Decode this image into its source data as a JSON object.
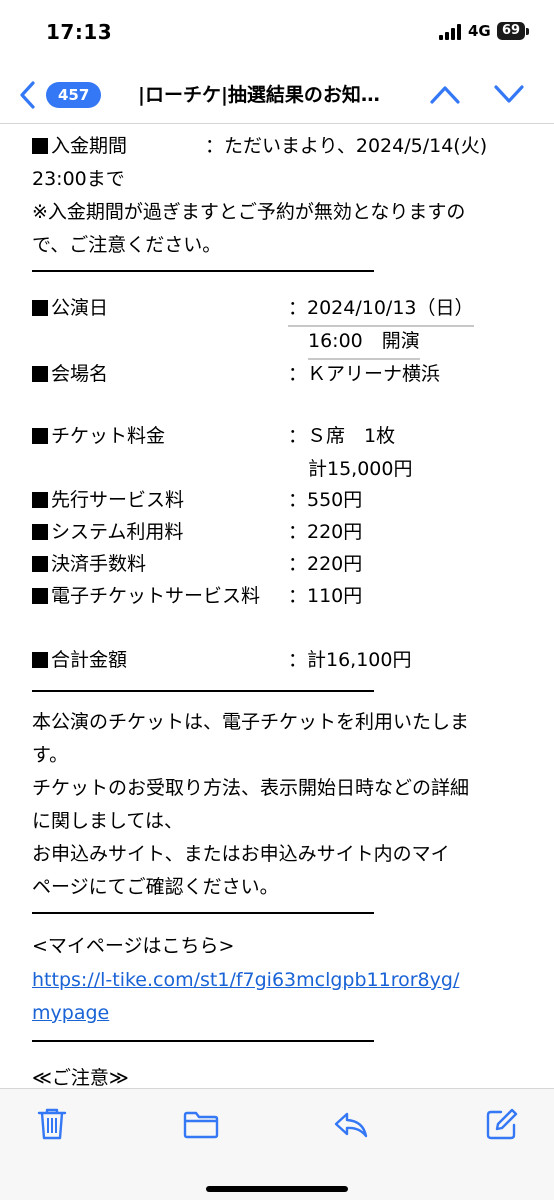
{
  "status": {
    "time": "17:13",
    "network": "4G",
    "battery": "69"
  },
  "nav": {
    "back_count": "457",
    "title": "|ローチケ|抽選結果のお知…"
  },
  "colors": {
    "accent": "#3478f6",
    "link": "#1a63d6"
  },
  "email": {
    "payment_period_label": "入金期間",
    "payment_period_value": "：ただいまより、2024/5/14(火)",
    "payment_period_end": "23:00まで",
    "notice_line1": "※入金期間が過ぎますとご予約が無効となりますの",
    "notice_line2": "で、ご注意ください。",
    "perf_date_label": "公演日",
    "perf_date_value": "：2024/10/13（日）",
    "perf_time_value": "16:00　開演",
    "venue_label": "会場名",
    "venue_value": "：Ｋアリーナ横浜",
    "ticket_fee_label": "チケット料金",
    "ticket_fee_value": "：Ｓ席　1枚",
    "ticket_fee_total": "計15,000円",
    "presale_fee_label": "先行サービス料",
    "presale_fee_value": "：550円",
    "system_fee_label": "システム利用料",
    "system_fee_value": "：220円",
    "settlement_fee_label": "決済手数料",
    "settlement_fee_value": "：220円",
    "eticket_fee_label": "電子チケットサービス料",
    "eticket_fee_value": "：110円",
    "total_label": "合計金額",
    "total_value": "：計16,100円",
    "eticket_info_line1": "本公演のチケットは、電子チケットを利用いたしま",
    "eticket_info_line2": "す。",
    "eticket_info_line3": "チケットのお受取り方法、表示開始日時などの詳細",
    "eticket_info_line4": "に関しましては、",
    "eticket_info_line5": "お申込みサイト、またはお申込みサイト内のマイ",
    "eticket_info_line6": "ページにてご確認ください。",
    "mypage_heading": "<マイページはこちら>",
    "mypage_link_line1": "https://l-tike.com/st1/f7gi63mclgpb11ror8yg/",
    "mypage_link_line2": "mypage",
    "caution_heading": "≪ご注意≫"
  },
  "toolbar": {
    "icons": [
      "trash-icon",
      "folder-icon",
      "reply-icon",
      "compose-icon"
    ]
  }
}
